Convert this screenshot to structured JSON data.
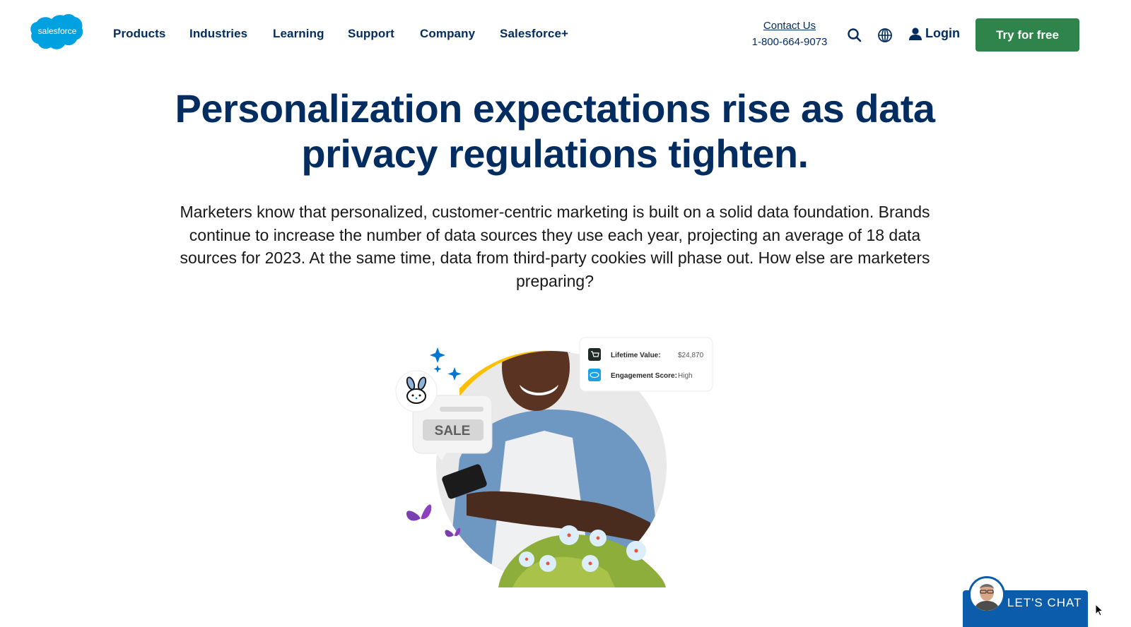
{
  "header": {
    "logo_text": "salesforce",
    "nav": [
      {
        "label": "Products"
      },
      {
        "label": "Industries"
      },
      {
        "label": "Learning"
      },
      {
        "label": "Support"
      },
      {
        "label": "Company"
      },
      {
        "label": "Salesforce+"
      }
    ],
    "contact_label": "Contact Us",
    "phone": "1-800-664-9073",
    "login_label": "Login",
    "cta_label": "Try for free",
    "icons": {
      "search": "search-icon",
      "globe": "globe-icon",
      "user": "user-icon"
    }
  },
  "hero": {
    "headline_line1": "Personalization expectations rise as data",
    "headline_line2": "privacy regulations tighten.",
    "body": "Marketers know that personalized, customer-centric marketing is built on a solid data foundation. Brands continue to increase the number of data sources they use each year, projecting an average of 18 data sources for 2023. At the same time, data from third-party cookies will phase out. How else are marketers preparing?"
  },
  "illustration": {
    "card": {
      "rows": [
        {
          "label": "Lifetime Value:",
          "value": "$24,870",
          "icon": "cart-icon"
        },
        {
          "label": "Engagement Score:",
          "value": "High",
          "icon": "cloud-icon"
        }
      ]
    },
    "sale_label": "SALE"
  },
  "chat": {
    "label": "LET'S CHAT"
  },
  "colors": {
    "brand_blue": "#032d60",
    "cta_green": "#2e844a",
    "logo_blue": "#00a1e0",
    "chat_blue": "#0b5cab",
    "accent_yellow": "#fcc003"
  }
}
